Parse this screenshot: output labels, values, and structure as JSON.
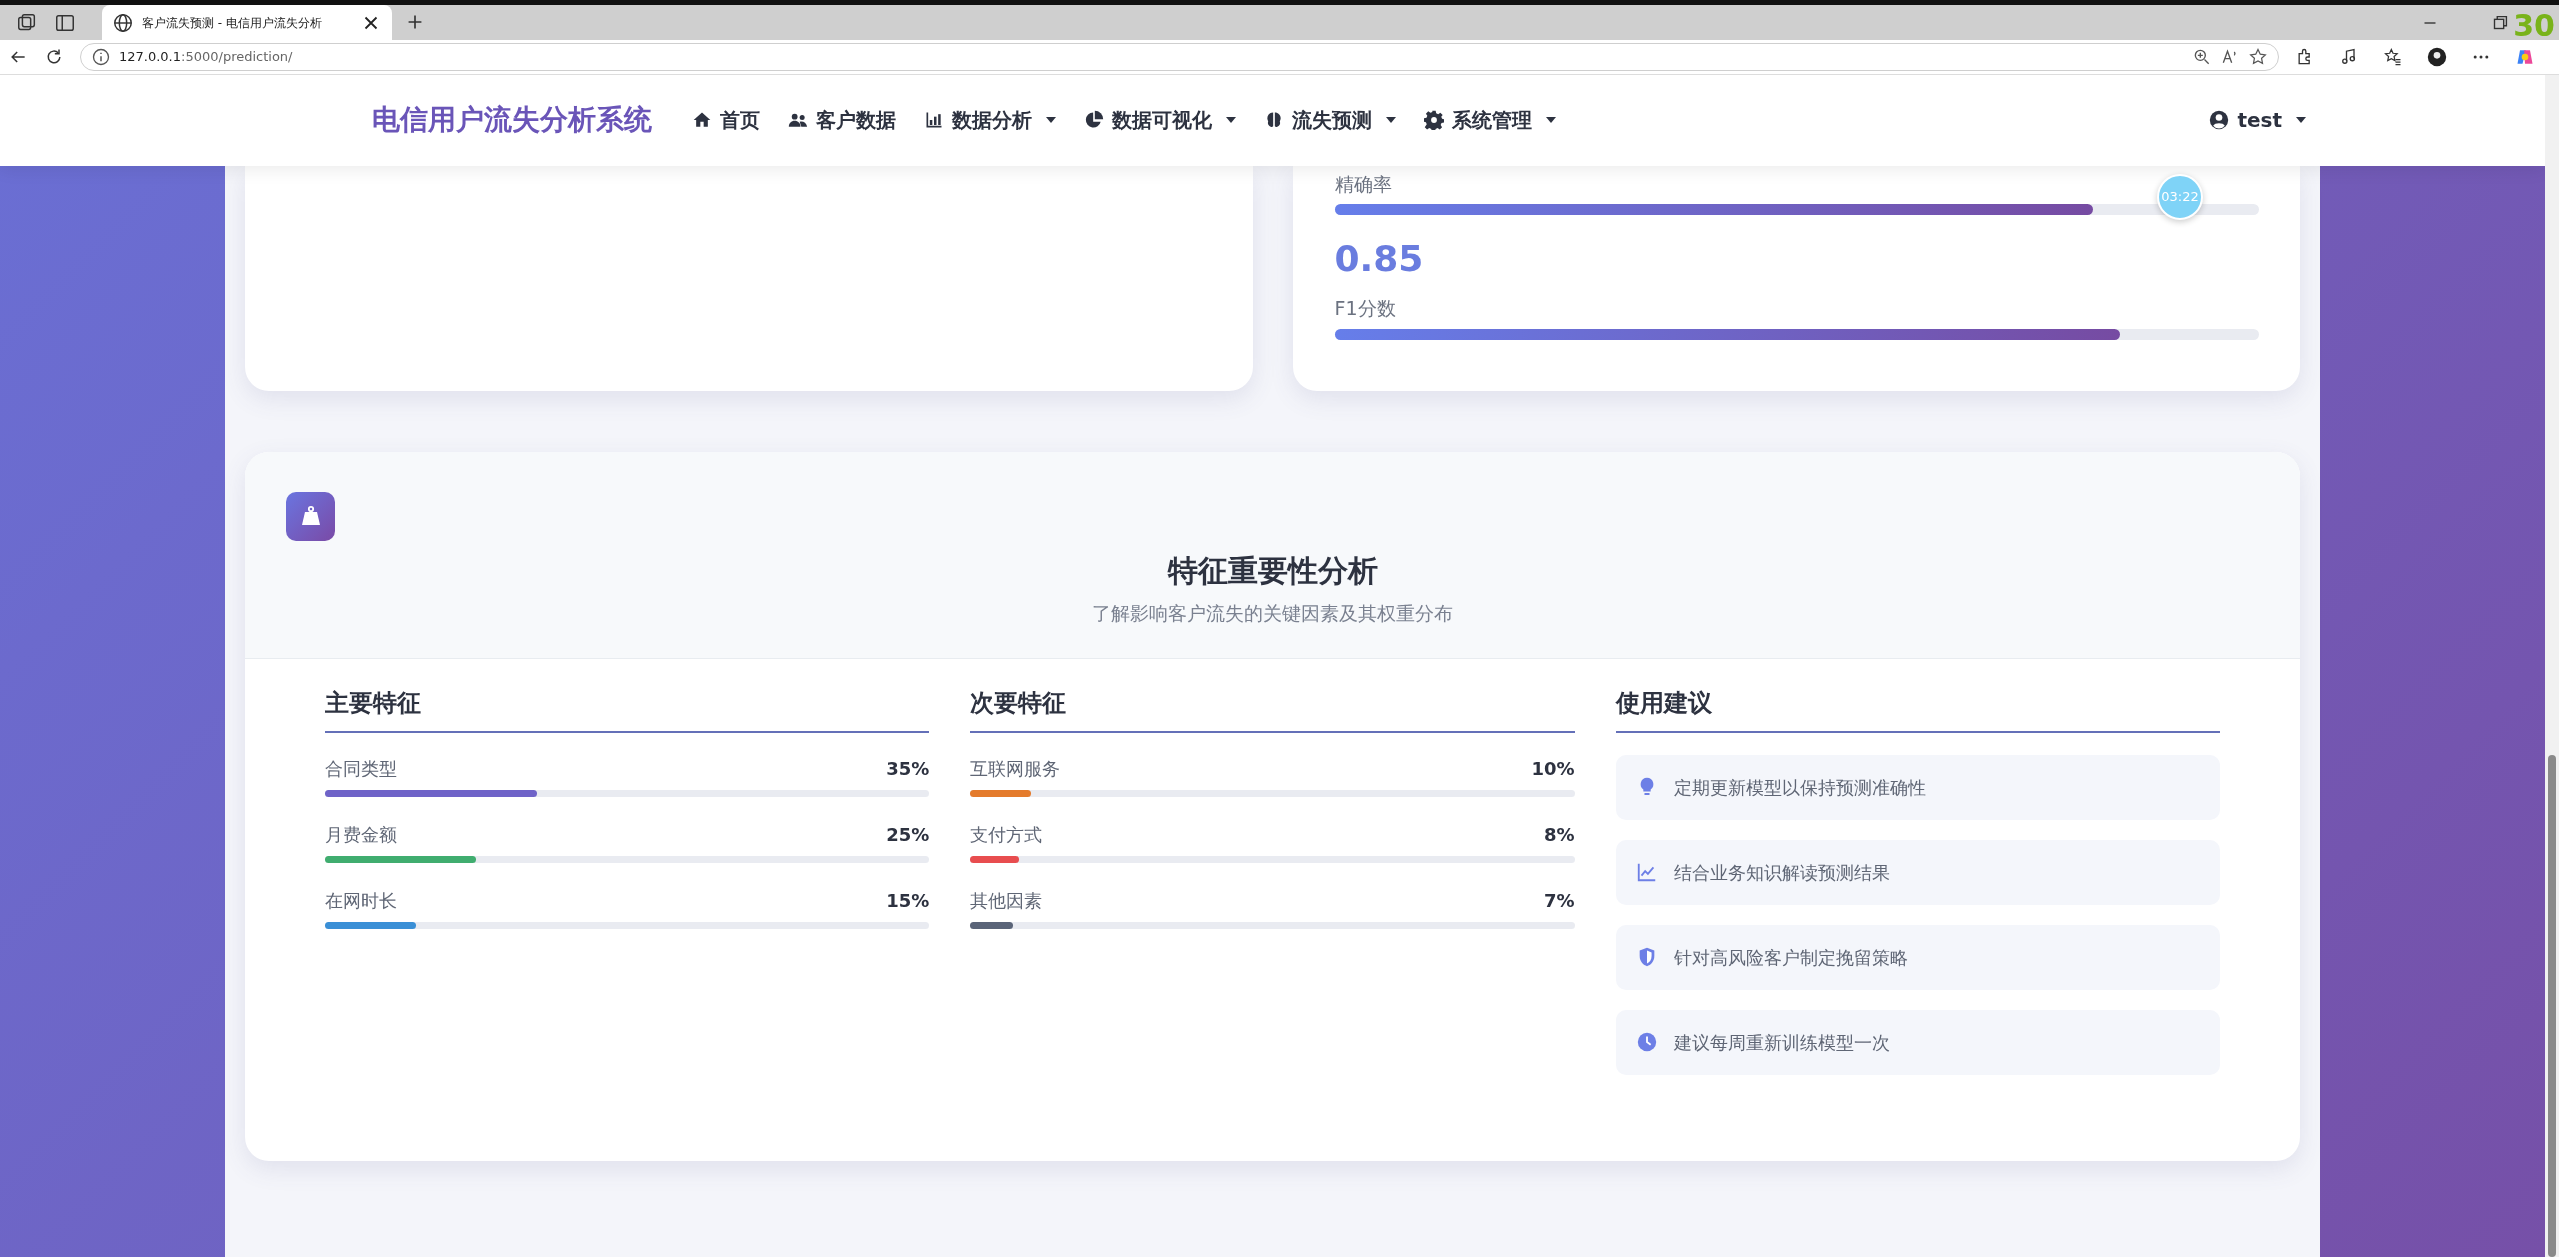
{
  "browser": {
    "tab_title": "客户流失预测 - 电信用户流失分析",
    "url_host": "127.0.0.1",
    "url_path": ":5000/prediction/"
  },
  "overlay": {
    "fps": "30",
    "timer": "03:22"
  },
  "navbar": {
    "brand": "电信用户流失分析系统",
    "items": [
      {
        "label": "首页",
        "dropdown": false
      },
      {
        "label": "客户数据",
        "dropdown": false
      },
      {
        "label": "数据分析",
        "dropdown": true
      },
      {
        "label": "数据可视化",
        "dropdown": true
      },
      {
        "label": "流失预测",
        "dropdown": true
      },
      {
        "label": "系统管理",
        "dropdown": true
      }
    ],
    "user": {
      "label": "test",
      "dropdown": true
    }
  },
  "metrics": [
    {
      "label": "精确率",
      "level": 0.82
    },
    {
      "value": "0.85",
      "label": "F1分数",
      "level": 0.85
    }
  ],
  "feature_section": {
    "title": "特征重要性分析",
    "subtitle": "了解影响客户流失的关键因素及其权重分布",
    "columns": [
      {
        "heading": "主要特征",
        "kind": "features",
        "items": [
          {
            "name": "合同类型",
            "percent": "35%",
            "level": 0.35,
            "color": "#6f63c8"
          },
          {
            "name": "月费金额",
            "percent": "25%",
            "level": 0.25,
            "color": "#40ad6f"
          },
          {
            "name": "在网时长",
            "percent": "15%",
            "level": 0.15,
            "color": "#3a8fd6"
          }
        ]
      },
      {
        "heading": "次要特征",
        "kind": "features",
        "items": [
          {
            "name": "互联网服务",
            "percent": "10%",
            "level": 0.1,
            "color": "#e47b2c"
          },
          {
            "name": "支付方式",
            "percent": "8%",
            "level": 0.08,
            "color": "#e84d4f"
          },
          {
            "name": "其他因素",
            "percent": "7%",
            "level": 0.07,
            "color": "#5a6478"
          }
        ]
      },
      {
        "heading": "使用建议",
        "kind": "tips",
        "items": [
          {
            "text": "定期更新模型以保持预测准确性"
          },
          {
            "text": "结合业务知识解读预测结果"
          },
          {
            "text": "针对高风险客户制定挽留策略"
          },
          {
            "text": "建议每周重新训练模型一次"
          }
        ]
      }
    ]
  }
}
